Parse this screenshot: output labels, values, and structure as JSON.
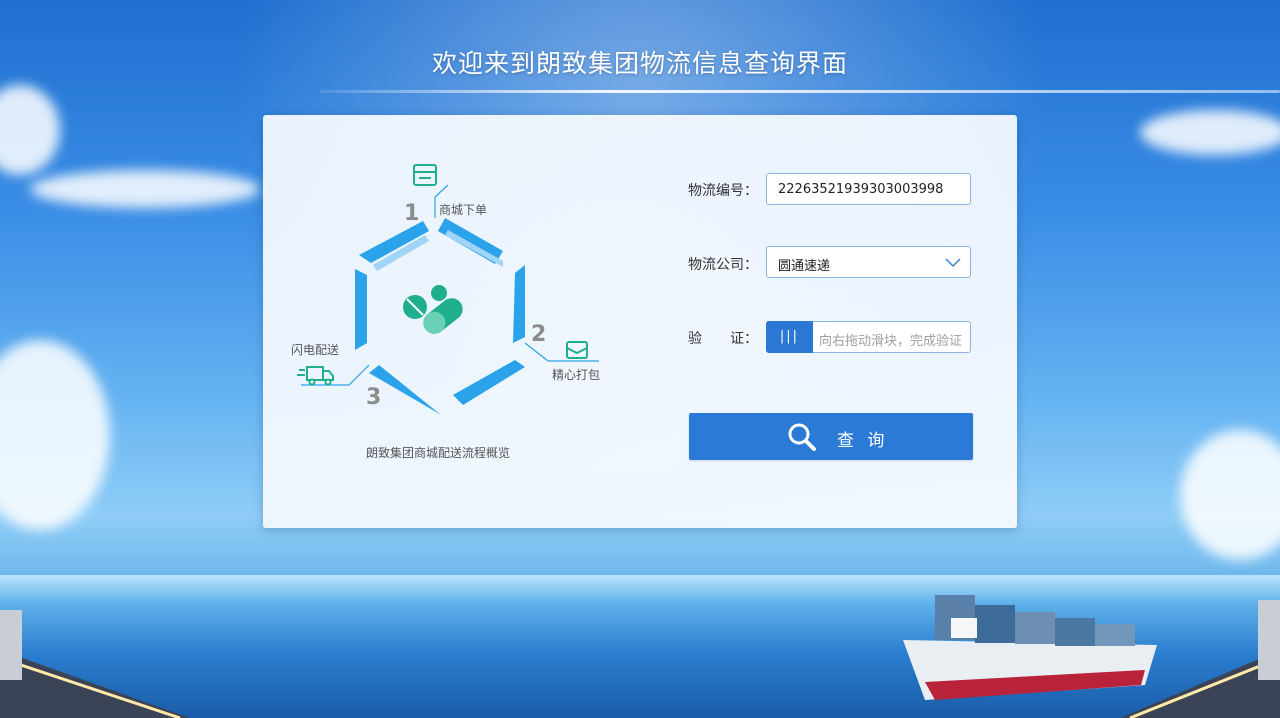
{
  "page": {
    "title": "欢迎来到朗致集团物流信息查询界面"
  },
  "diagram": {
    "steps": [
      {
        "number": "1",
        "label": "商城下单",
        "icon": "store-icon"
      },
      {
        "number": "2",
        "label": "精心打包",
        "icon": "package-box-icon"
      },
      {
        "number": "3",
        "label": "闪电配送",
        "icon": "delivery-truck-icon"
      }
    ],
    "center_icon": "capsule-pills-icon",
    "caption": "朗致集团商城配送流程概览"
  },
  "form": {
    "tracking_label": "物流编号：",
    "tracking_value": "22263521939303003998",
    "company_label": "物流公司：",
    "company_value": "圆通速递",
    "verify_label": "验　　证：",
    "slider_handle_text": "|||",
    "slider_hint": "向右拖动滑块，完成验证",
    "query_button": "查 询"
  },
  "colors": {
    "accent_blue": "#2b7ad6",
    "hexagon_blue": "#2ba3ea",
    "icon_teal": "#1fae8e"
  }
}
